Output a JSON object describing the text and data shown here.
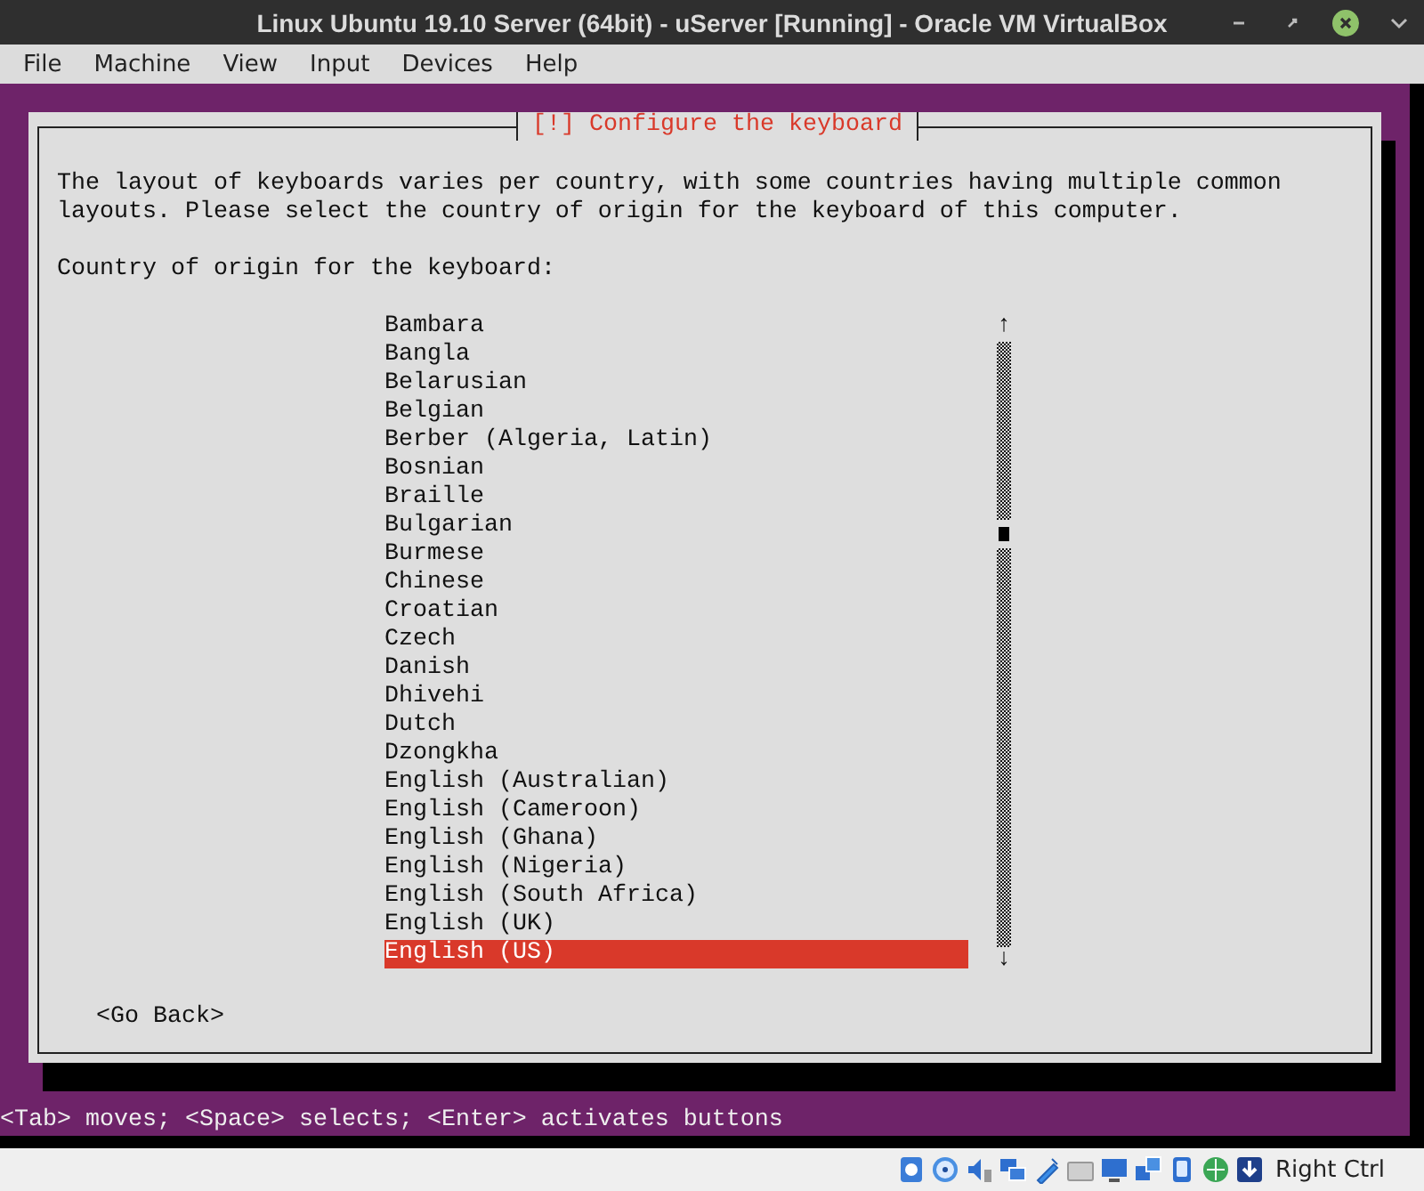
{
  "window": {
    "title": "Linux Ubuntu 19.10 Server (64bit) - uServer [Running] - Oracle VM VirtualBox"
  },
  "menu": [
    "File",
    "Machine",
    "View",
    "Input",
    "Devices",
    "Help"
  ],
  "dialog": {
    "title": "[!] Configure the keyboard",
    "description": "The layout of keyboards varies per country, with some countries having multiple common layouts. Please select the country of origin for the keyboard of this computer.",
    "prompt": "Country of origin for the keyboard:",
    "list": [
      {
        "label": "Bambara",
        "selected": false
      },
      {
        "label": "Bangla",
        "selected": false
      },
      {
        "label": "Belarusian",
        "selected": false
      },
      {
        "label": "Belgian",
        "selected": false
      },
      {
        "label": "Berber (Algeria, Latin)",
        "selected": false
      },
      {
        "label": "Bosnian",
        "selected": false
      },
      {
        "label": "Braille",
        "selected": false
      },
      {
        "label": "Bulgarian",
        "selected": false
      },
      {
        "label": "Burmese",
        "selected": false
      },
      {
        "label": "Chinese",
        "selected": false
      },
      {
        "label": "Croatian",
        "selected": false
      },
      {
        "label": "Czech",
        "selected": false
      },
      {
        "label": "Danish",
        "selected": false
      },
      {
        "label": "Dhivehi",
        "selected": false
      },
      {
        "label": "Dutch",
        "selected": false
      },
      {
        "label": "Dzongkha",
        "selected": false
      },
      {
        "label": "English (Australian)",
        "selected": false
      },
      {
        "label": "English (Cameroon)",
        "selected": false
      },
      {
        "label": "English (Ghana)",
        "selected": false
      },
      {
        "label": "English (Nigeria)",
        "selected": false
      },
      {
        "label": "English (South Africa)",
        "selected": false
      },
      {
        "label": "English (UK)",
        "selected": false
      },
      {
        "label": "English (US)",
        "selected": true
      }
    ],
    "scroll_up": "↑",
    "scroll_down": "↓",
    "back_button": "<Go Back>"
  },
  "console_hint": "<Tab> moves; <Space> selects; <Enter> activates buttons",
  "status_bar": {
    "host_key": "Right Ctrl"
  }
}
